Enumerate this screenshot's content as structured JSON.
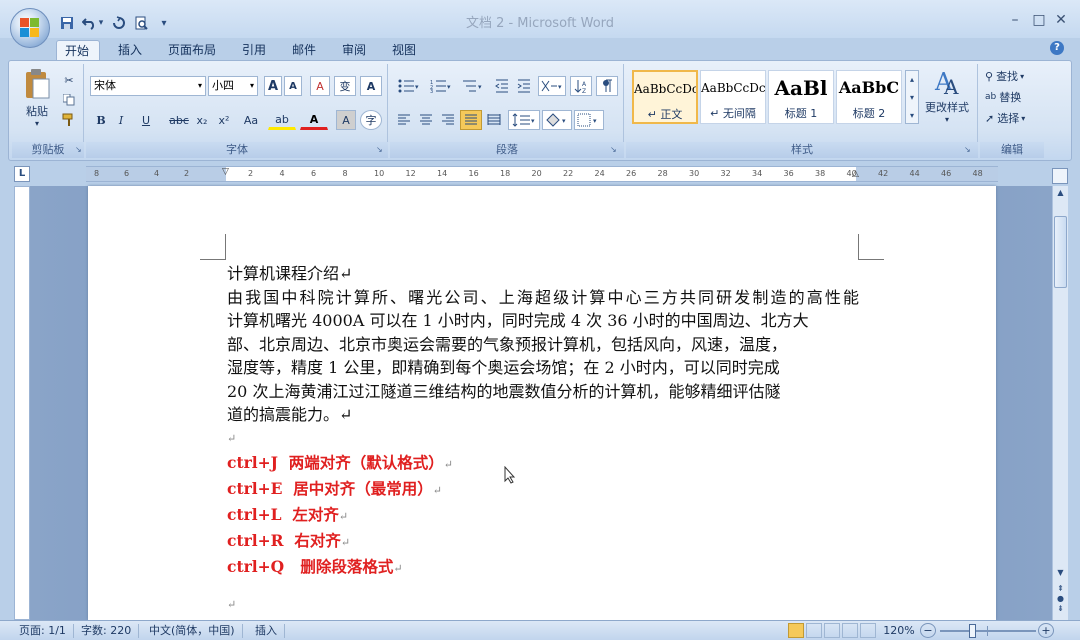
{
  "window": {
    "title": "文档 2 - Microsoft Word",
    "minimize": "–",
    "maximize": "□",
    "close": "✕"
  },
  "qat": {
    "save_icon": "save-icon",
    "undo_icon": "undo-icon",
    "redo_icon": "redo-icon",
    "preview_icon": "print-preview-icon",
    "more": "▾"
  },
  "tabs": [
    {
      "label": "开始"
    },
    {
      "label": "插入"
    },
    {
      "label": "页面布局"
    },
    {
      "label": "引用"
    },
    {
      "label": "邮件"
    },
    {
      "label": "审阅"
    },
    {
      "label": "视图"
    }
  ],
  "help": "?",
  "ribbon": {
    "clipboard": {
      "paste_label": "粘贴",
      "group_label": "剪贴板"
    },
    "font": {
      "font_name": "宋体",
      "font_size": "小四",
      "group_label": "字体",
      "bold": "B",
      "italic": "I",
      "underline": "U",
      "strike": "abc",
      "subscript": "x₂",
      "superscript": "x²",
      "change_case": "Aa",
      "grow": "A",
      "shrink": "A",
      "clear": "A",
      "phonetic": "变",
      "border": "A",
      "color": "A",
      "highlight": "ab",
      "shade": "A",
      "enclose": "字"
    },
    "paragraph": {
      "group_label": "段落"
    },
    "styles": {
      "group_label": "样式",
      "change_styles_label": "更改样式",
      "items": [
        {
          "sample": "AaBbCcDc",
          "name": "↵ 正文"
        },
        {
          "sample": "AaBbCcDc",
          "name": "↵ 无间隔"
        },
        {
          "sample": "AaBl",
          "name": "标题 1"
        },
        {
          "sample": "AaBbC",
          "name": "标题 2"
        }
      ]
    },
    "editing": {
      "group_label": "编辑",
      "find": "查找",
      "replace": "替换",
      "select": "选择"
    }
  },
  "ruler": {
    "left_numbers": [
      "8",
      "6",
      "4",
      "2"
    ],
    "numbers": [
      "2",
      "4",
      "6",
      "8",
      "10",
      "12",
      "14",
      "16",
      "18",
      "20",
      "22",
      "24",
      "26",
      "28",
      "30",
      "32",
      "34",
      "36",
      "38",
      "40",
      "42",
      "44",
      "46",
      "48"
    ],
    "tab_selector": "L"
  },
  "document": {
    "title": "计算机课程介绍↵",
    "lines": [
      "由我国中科院计算所、曙光公司、上海超级计算中心三方共同研发制造的高性能",
      "计算机曙光 4000A 可以在 1 小时内，同时完成 4 次 36 小时的中国周边、北方大",
      "部、北京周边、北京市奥运会需要的气象预报计算机，包括风向，风速，温度，",
      "湿度等，精度 1 公里，即精确到每个奥运会场馆；在 2 小时内，可以同时完成",
      "20 次上海黄浦江过江隧道三维结构的地震数值分析的计算机，能够精细评估隧",
      "道的搞震能力。↵"
    ],
    "blank_mark": "↵",
    "commands": [
      {
        "key": "ctrl+J",
        "desc": "两端对齐（默认格式）"
      },
      {
        "key": "ctrl+E",
        "desc": "居中对齐（最常用）"
      },
      {
        "key": "ctrl+L",
        "desc": "左对齐"
      },
      {
        "key": "ctrl+R",
        "desc": "右对齐"
      },
      {
        "key": "ctrl+Q",
        "desc": "删除段落格式"
      }
    ],
    "return_mark": "↵"
  },
  "status": {
    "page": "页面: 1/1",
    "words": "字数: 220",
    "language": "中文(简体，中国)",
    "mode": "插入",
    "zoom": "120%",
    "zoom_minus": "−",
    "zoom_plus": "+",
    "zoom_level": 0.33
  },
  "colors": {
    "accent": "#e02020",
    "ribbon": "#d5e3f3"
  }
}
